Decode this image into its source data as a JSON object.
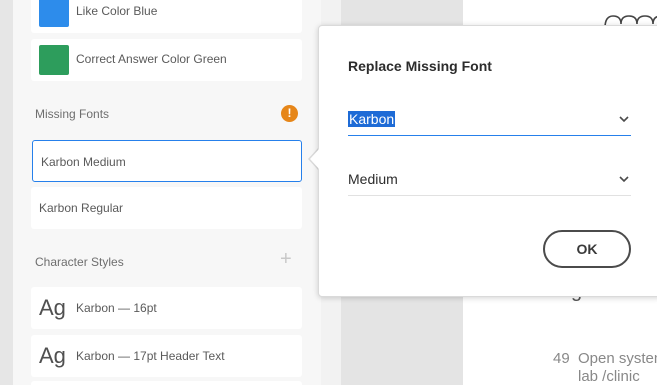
{
  "color_swatches": [
    {
      "label": "Like Color Blue",
      "color": "#2d8ceb"
    },
    {
      "label": "Correct Answer Color Green",
      "color": "#2d9d5c"
    }
  ],
  "missing_fonts": {
    "title": "Missing Fonts",
    "warning_icon": "!",
    "items": [
      {
        "label": "Karbon Medium",
        "selected": true
      },
      {
        "label": "Karbon Regular",
        "selected": false
      }
    ]
  },
  "character_styles": {
    "title": "Character Styles",
    "add_icon": "+",
    "items": [
      {
        "preview": "Ag",
        "label": "Karbon — 16pt"
      },
      {
        "preview": "Ag",
        "label": "Karbon — 17pt Header Text"
      }
    ]
  },
  "artboard": {
    "line_number": "49",
    "text_line_1": "Open system",
    "text_line_2": "lab /clinic"
  },
  "dialog": {
    "title": "Replace Missing Font",
    "font_family": "Karbon",
    "font_style": "Medium",
    "ok_label": "OK"
  },
  "colors": {
    "accent": "#2680eb",
    "warning": "#e68619"
  }
}
